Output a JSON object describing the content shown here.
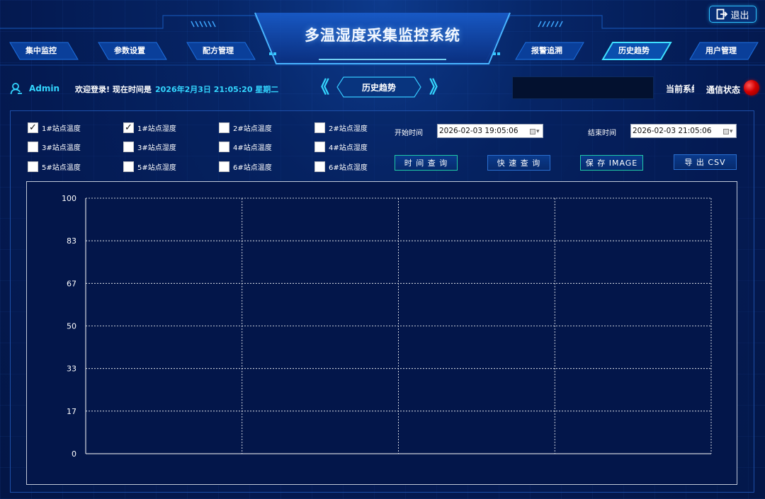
{
  "app": {
    "title": "多温湿度采集监控系统",
    "exit_label": "退出"
  },
  "nav": {
    "left": [
      "集中监控",
      "参数设置",
      "配方管理"
    ],
    "right": [
      "报警追溯",
      "历史趋势",
      "用户管理"
    ],
    "active": "历史趋势"
  },
  "info": {
    "user": "Admin",
    "welcome": "欢迎登录! 现在时间是",
    "datetime": "2026年2月3日 21:05:20 星期二",
    "page_title": "历史趋势",
    "current_system": "当前系统",
    "comm_status": "通信状态",
    "comm_status_color": "#d40000"
  },
  "filters": {
    "checkboxes": [
      {
        "label": "1#站点温度",
        "checked": true
      },
      {
        "label": "1#站点湿度",
        "checked": true
      },
      {
        "label": "2#站点温度",
        "checked": false
      },
      {
        "label": "2#站点湿度",
        "checked": false
      },
      {
        "label": "3#站点温度",
        "checked": false
      },
      {
        "label": "3#站点湿度",
        "checked": false
      },
      {
        "label": "4#站点温度",
        "checked": false
      },
      {
        "label": "4#站点湿度",
        "checked": false
      },
      {
        "label": "5#站点温度",
        "checked": false
      },
      {
        "label": "5#站点湿度",
        "checked": false
      },
      {
        "label": "6#站点温度",
        "checked": false
      },
      {
        "label": "6#站点湿度",
        "checked": false
      }
    ],
    "start_label": "开始时间",
    "start_value": "2026-02-03 19:05:06",
    "end_label": "结束时间",
    "end_value": "2026-02-03 21:05:06",
    "buttons": [
      "时 间 查 询",
      "快 速 查 询",
      "保 存 IMAGE",
      "导 出 CSV"
    ]
  },
  "chart_data": {
    "type": "line",
    "yticks": [
      "100",
      "83",
      "67",
      "50",
      "33",
      "17",
      "0"
    ],
    "ylim": [
      0,
      100
    ],
    "x_divisions": 4,
    "grid": true,
    "series": []
  }
}
